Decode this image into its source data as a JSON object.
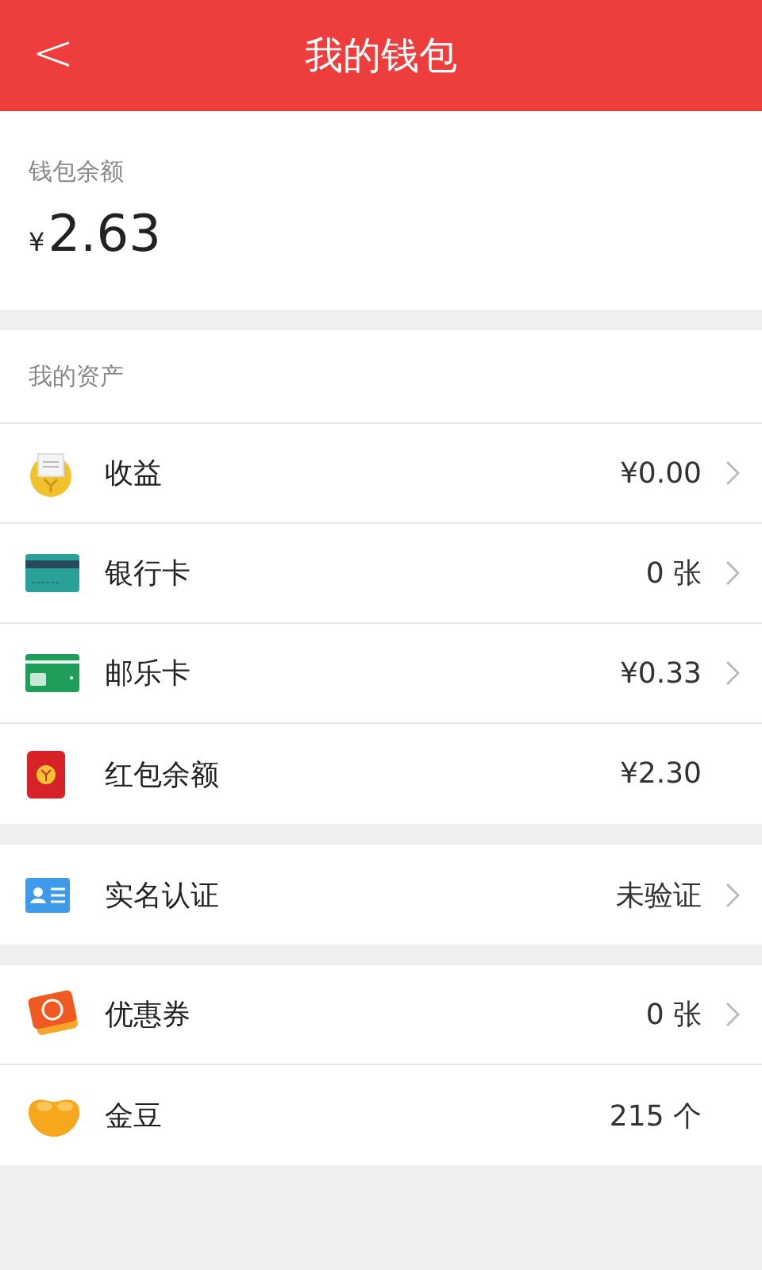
{
  "header": {
    "back_icon": "<",
    "title": "我的钱包"
  },
  "balance": {
    "label": "钱包余额",
    "currency": "¥",
    "amount": "2.63"
  },
  "groups": [
    {
      "title": "我的资产",
      "rows": [
        {
          "kind": "income",
          "label": "收益",
          "value": "¥0.00",
          "chevron": true
        },
        {
          "kind": "bank-card",
          "label": "银行卡",
          "value": "0 张",
          "chevron": true
        },
        {
          "kind": "post-card",
          "label": "邮乐卡",
          "value": "¥0.33",
          "chevron": true
        },
        {
          "kind": "red-packet",
          "label": "红包余额",
          "value": "¥2.30",
          "chevron": false
        }
      ]
    },
    {
      "rows": [
        {
          "kind": "id-card",
          "label": "实名认证",
          "value": "未验证",
          "chevron": true
        }
      ]
    },
    {
      "rows": [
        {
          "kind": "coupon",
          "label": "优惠券",
          "value": "0 张",
          "chevron": true
        },
        {
          "kind": "bean",
          "label": "金豆",
          "value": "215 个",
          "chevron": false
        }
      ]
    }
  ]
}
